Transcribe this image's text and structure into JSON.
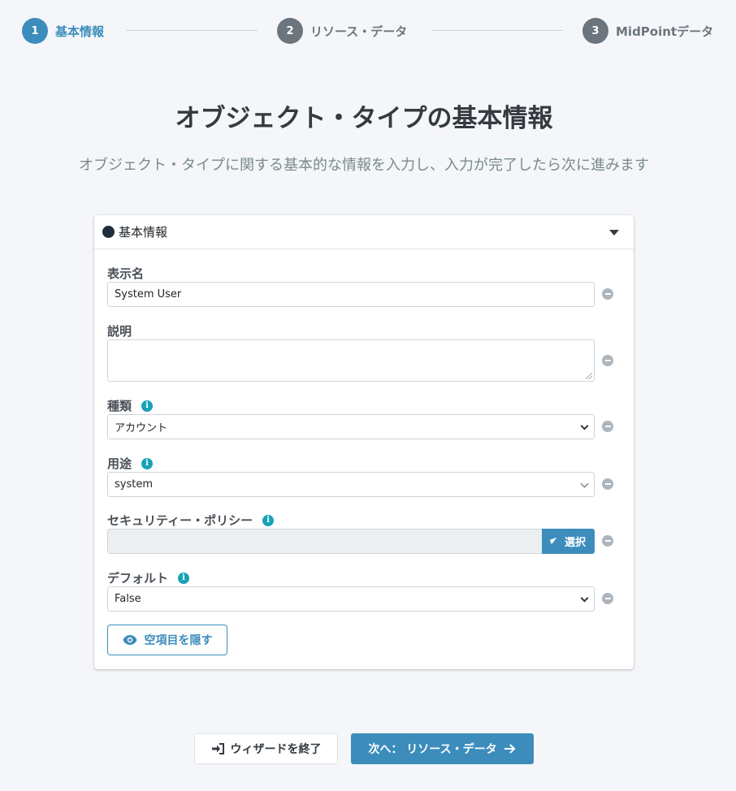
{
  "stepper": {
    "steps": [
      {
        "number": "1",
        "label": "基本情報",
        "active": true
      },
      {
        "number": "2",
        "label": "リソース・データ",
        "active": false
      },
      {
        "number": "3",
        "label": "MidPointデータ",
        "active": false
      }
    ]
  },
  "page": {
    "title": "オブジェクト・タイプの基本情報",
    "subtitle": "オブジェクト・タイプに関する基本的な情報を入力し、入力が完了したら次に進みます"
  },
  "panel": {
    "title": "基本情報",
    "fields": {
      "display_name": {
        "label": "表示名",
        "value": "System User"
      },
      "description": {
        "label": "説明",
        "value": ""
      },
      "kind": {
        "label": "種類",
        "value": "アカウント"
      },
      "intent": {
        "label": "用途",
        "value": "system"
      },
      "security_policy": {
        "label": "セキュリティー・ポリシー",
        "value": "",
        "button": "選択"
      },
      "default": {
        "label": "デフォルト",
        "value": "False"
      }
    },
    "hide_empty_button": "空項目を隠す"
  },
  "footer": {
    "exit_button": "ウィザードを終了",
    "next_button": "次へ： リソース・データ"
  },
  "colors": {
    "accent": "#3c8dbc",
    "info": "#17a2b8",
    "background": "#f4f6f9"
  }
}
